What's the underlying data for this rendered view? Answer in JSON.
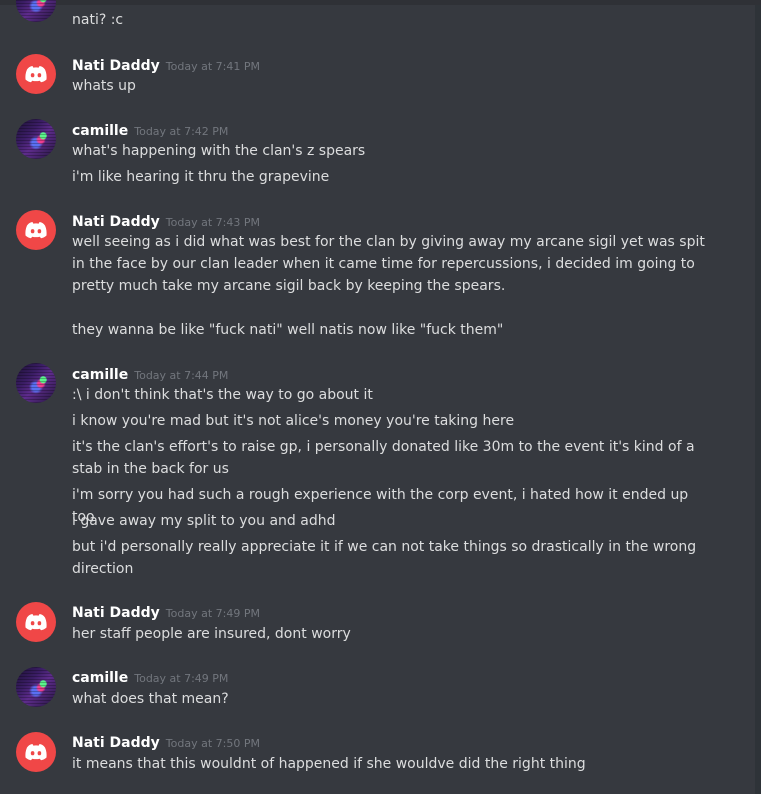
{
  "colors": {
    "background": "#36393f",
    "username": "#ffffff",
    "timestamp": "#72767d",
    "message_text": "#dcddde",
    "discord_avatar": "#f04747"
  },
  "messages": [
    {
      "lines": [
        "nati? :c"
      ]
    },
    {
      "username": "Nati Daddy",
      "avatar": "discord-logo-icon",
      "timestamp": "Today at 7:41 PM",
      "lines": [
        "whats up"
      ]
    },
    {
      "username": "camille",
      "avatar": "camille-avatar",
      "timestamp": "Today at 7:42 PM",
      "lines": [
        "what's happening with the clan's z spears",
        "i'm like hearing it thru the grapevine"
      ]
    },
    {
      "username": "Nati Daddy",
      "avatar": "discord-logo-icon",
      "timestamp": "Today at 7:43 PM",
      "lines": [
        "well seeing as i did what was best for the clan by giving away my arcane sigil yet was spit in the face by our clan leader when it came time for repercussions, i decided im going to pretty much take my arcane sigil back by keeping the spears.",
        "they wanna be like \"fuck nati\" well natis now like \"fuck them\""
      ]
    },
    {
      "username": "camille",
      "avatar": "camille-avatar",
      "timestamp": "Today at 7:44 PM",
      "lines": [
        ":\\ i don't think that's the way to go about it",
        "i know you're mad but it's not alice's money you're taking here",
        "it's the clan's effort's to raise gp, i personally donated like 30m to the event it's kind of a stab in the back for us",
        "i'm sorry you had such a rough experience with the corp event, i hated how it ended up too",
        "i gave away my split to you and adhd",
        "but i'd personally really appreciate it if we can not take things so drastically in the wrong direction"
      ]
    },
    {
      "username": "Nati Daddy",
      "avatar": "discord-logo-icon",
      "timestamp": "Today at 7:49 PM",
      "lines": [
        "her staff people are insured, dont worry"
      ]
    },
    {
      "username": "camille",
      "avatar": "camille-avatar",
      "timestamp": "Today at 7:49 PM",
      "lines": [
        "what does that mean?"
      ]
    },
    {
      "username": "Nati Daddy",
      "avatar": "discord-logo-icon",
      "timestamp": "Today at 7:50 PM",
      "lines": [
        "it means that this wouldnt of happened if she wouldve did the right thing"
      ]
    }
  ]
}
